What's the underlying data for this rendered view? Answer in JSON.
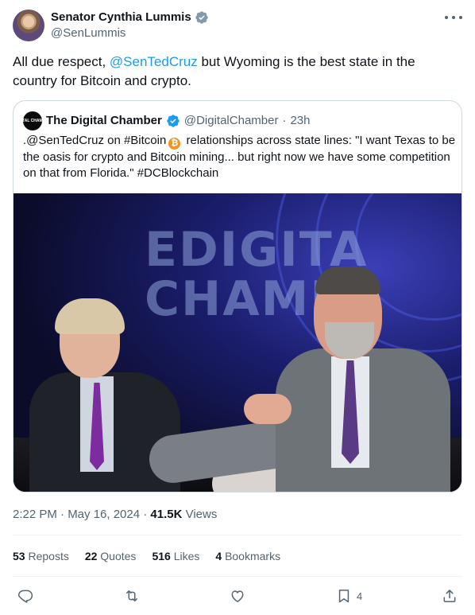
{
  "author": {
    "name": "Senator Cynthia Lummis",
    "handle": "@SenLummis"
  },
  "tweet": {
    "text_before": "All due respect, ",
    "mention": "@SenTedCruz",
    "text_after": " but Wyoming is the best state in the country for Bitcoin and crypto."
  },
  "quote": {
    "avatar_text": "DIGITAL CHAMBER",
    "name": "The Digital Chamber",
    "handle": "@DigitalChamber",
    "separator": "·",
    "time": "23h",
    "text_part1": ".@SenTedCruz on #Bitcoin",
    "text_part2": " relationships across state lines: \"I want Texas to be the oasis for crypto and Bitcoin mining... but right now we have some competition on that from Florida.\" #DCBlockchain",
    "image_wall_text_line1": "EDIGITA",
    "image_wall_text_line2": "CHAMBE"
  },
  "meta": {
    "timestamp": "2:22 PM · May 16, 2024 · ",
    "views_count": "41.5K",
    "views_label": " Views"
  },
  "stats": {
    "reposts_count": "53",
    "reposts_label": "Reposts",
    "quotes_count": "22",
    "quotes_label": "Quotes",
    "likes_count": "516",
    "likes_label": "Likes",
    "bookmarks_count": "4",
    "bookmarks_label": "Bookmarks"
  },
  "actions": {
    "bookmark_count": "4"
  },
  "colors": {
    "accent": "#1d9bf0",
    "secondary_text": "#536471",
    "bitcoin": "#f7931a"
  },
  "icons": [
    "verified-badge-icon",
    "more-icon",
    "reply-icon",
    "repost-icon",
    "like-icon",
    "bookmark-icon",
    "share-icon",
    "bitcoin-icon"
  ]
}
